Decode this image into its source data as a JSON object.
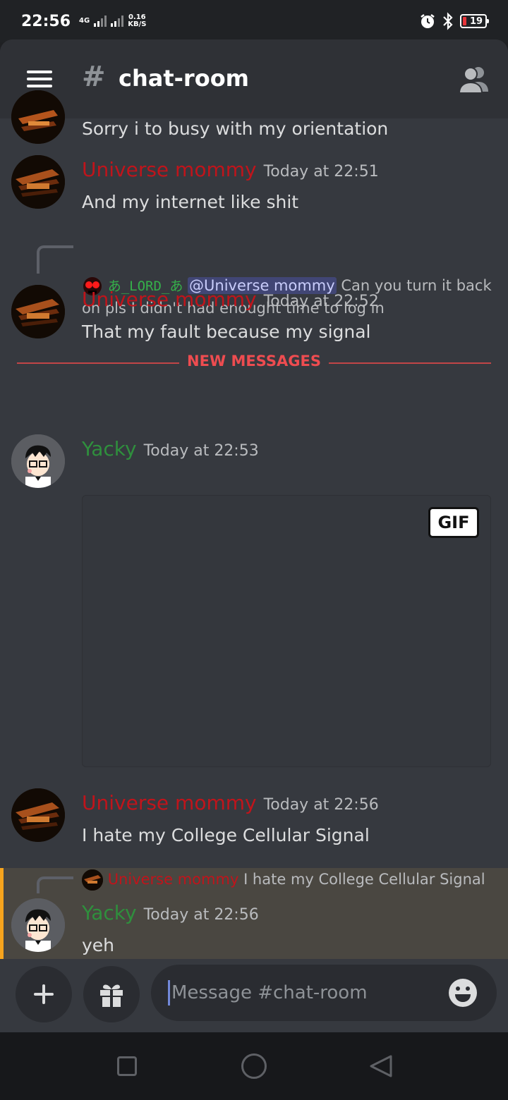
{
  "status_bar": {
    "time": "22:56",
    "network": "4G",
    "speed_value": "0.16",
    "speed_unit": "KB/S",
    "battery": "19",
    "icons": [
      "alarm-icon",
      "bluetooth-icon",
      "battery-icon"
    ]
  },
  "header": {
    "hash": "#",
    "channel": "chat-room",
    "icons": [
      "hamburger-icon",
      "members-icon"
    ]
  },
  "messages": [
    {
      "text": "Sorry i to busy with my orientation"
    },
    {
      "author": "Universe mommy",
      "timestamp": "Today at 22:51",
      "text": "And my internet like shit"
    },
    {
      "reply": {
        "author": "あ_LORD_あ",
        "mention": "@Universe mommy",
        "text_line1": "Can you turn it back",
        "text_line2": "on pls I didn't had enought time to log in"
      },
      "author": "Universe mommy",
      "timestamp": "Today at 22:52",
      "text": "That my fault because my signal"
    },
    {
      "author": "Yacky",
      "timestamp": "Today at 22:53",
      "attachment": "GIF"
    },
    {
      "author": "Universe mommy",
      "timestamp": "Today at 22:56",
      "text": "I hate my College Cellular Signal"
    },
    {
      "reply": {
        "author": "Universe mommy",
        "text": "I hate my College Cellular Signal"
      },
      "author": "Yacky",
      "timestamp": "Today at 22:56",
      "text": "yeh"
    }
  ],
  "divider": "NEW MESSAGES",
  "composer": {
    "placeholder": "Message #chat-room",
    "icons": [
      "plus-icon",
      "gift-icon",
      "emoji-icon"
    ]
  },
  "colors": {
    "author_red": "#c0141b",
    "author_green": "#2f8f3d",
    "new_messages": "#ee4c50",
    "mention_bg": "#414675",
    "highlight_bar": "#f7a41d"
  }
}
